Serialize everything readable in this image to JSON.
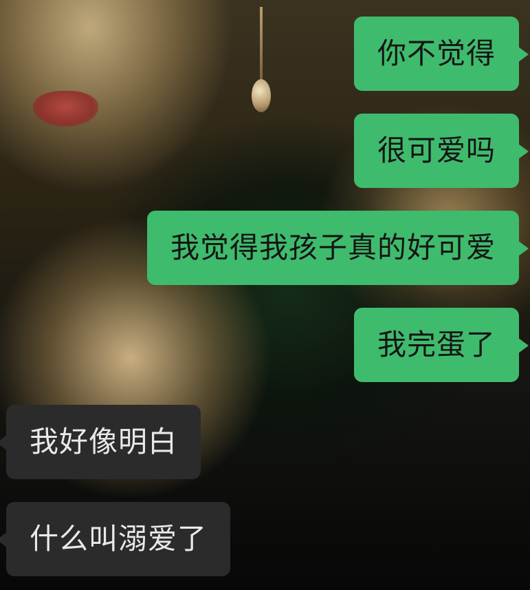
{
  "messages": [
    {
      "side": "out",
      "text": "你不觉得"
    },
    {
      "side": "out",
      "text": "很可爱吗"
    },
    {
      "side": "out",
      "text": "我觉得我孩子真的好可爱"
    },
    {
      "side": "out",
      "text": "我完蛋了"
    },
    {
      "side": "in",
      "text": "我好像明白"
    },
    {
      "side": "in",
      "text": "什么叫溺爱了"
    }
  ],
  "colors": {
    "outgoing_bubble": "#3fbb6d",
    "incoming_bubble": "#2b2b2b",
    "outgoing_text": "#151515",
    "incoming_text": "#e9e9e9"
  }
}
